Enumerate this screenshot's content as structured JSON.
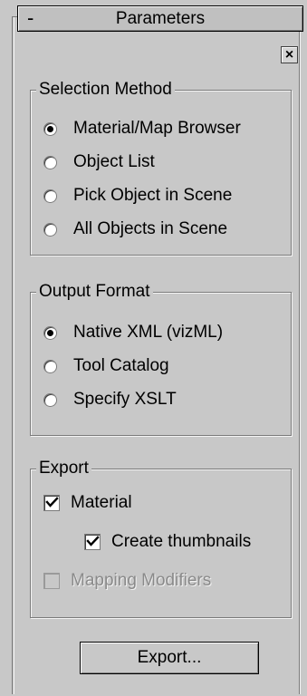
{
  "rollout": {
    "collapse_symbol": "-",
    "title": "Parameters",
    "close_symbol": "×"
  },
  "selection_method": {
    "title": "Selection Method",
    "options": [
      {
        "label": "Material/Map Browser",
        "selected": true
      },
      {
        "label": "Object List",
        "selected": false
      },
      {
        "label": "Pick Object in Scene",
        "selected": false
      },
      {
        "label": "All Objects in Scene",
        "selected": false
      }
    ]
  },
  "output_format": {
    "title": "Output Format",
    "options": [
      {
        "label": "Native XML (vizML)",
        "selected": true
      },
      {
        "label": "Tool Catalog",
        "selected": false
      },
      {
        "label": "Specify XSLT",
        "selected": false
      }
    ]
  },
  "export": {
    "title": "Export",
    "material": {
      "label": "Material",
      "checked": true,
      "enabled": true
    },
    "create_thumbnails": {
      "label": "Create thumbnails",
      "checked": true,
      "enabled": true
    },
    "mapping_modifiers": {
      "label": "Mapping Modifiers",
      "checked": false,
      "enabled": false
    },
    "button_label": "Export..."
  }
}
